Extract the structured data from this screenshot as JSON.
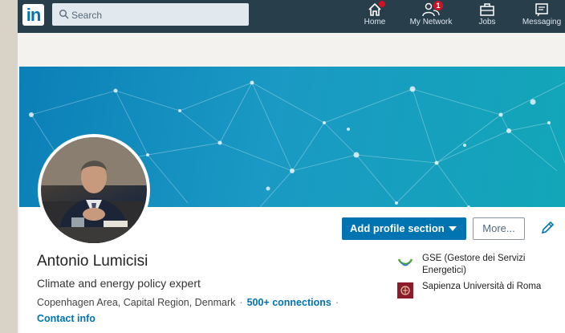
{
  "nav": {
    "logo_text": "in",
    "search_placeholder": "Search",
    "items": [
      {
        "label": "Home",
        "icon": "home-icon",
        "badge": ""
      },
      {
        "label": "My Network",
        "icon": "network-icon",
        "badge": "1"
      },
      {
        "label": "Jobs",
        "icon": "briefcase-icon",
        "badge": ""
      },
      {
        "label": "Messaging",
        "icon": "messaging-icon",
        "badge": ""
      }
    ]
  },
  "profile": {
    "name": "Antonio Lumicisi",
    "headline": "Climate and energy policy expert",
    "location": "Copenhagen Area, Capital Region, Denmark",
    "connections": "500+ connections",
    "contact_info": "Contact info",
    "add_section_label": "Add profile section",
    "more_label": "More...",
    "organizations": [
      {
        "name": "GSE (Gestore dei Servizi Energetici)",
        "icon": "gse-logo-icon"
      },
      {
        "name": "Sapienza Università di Roma",
        "icon": "sapienza-logo-icon"
      }
    ]
  },
  "colors": {
    "nav_bg": "#283e4a",
    "accent": "#0073b1",
    "badge": "#d11124"
  }
}
